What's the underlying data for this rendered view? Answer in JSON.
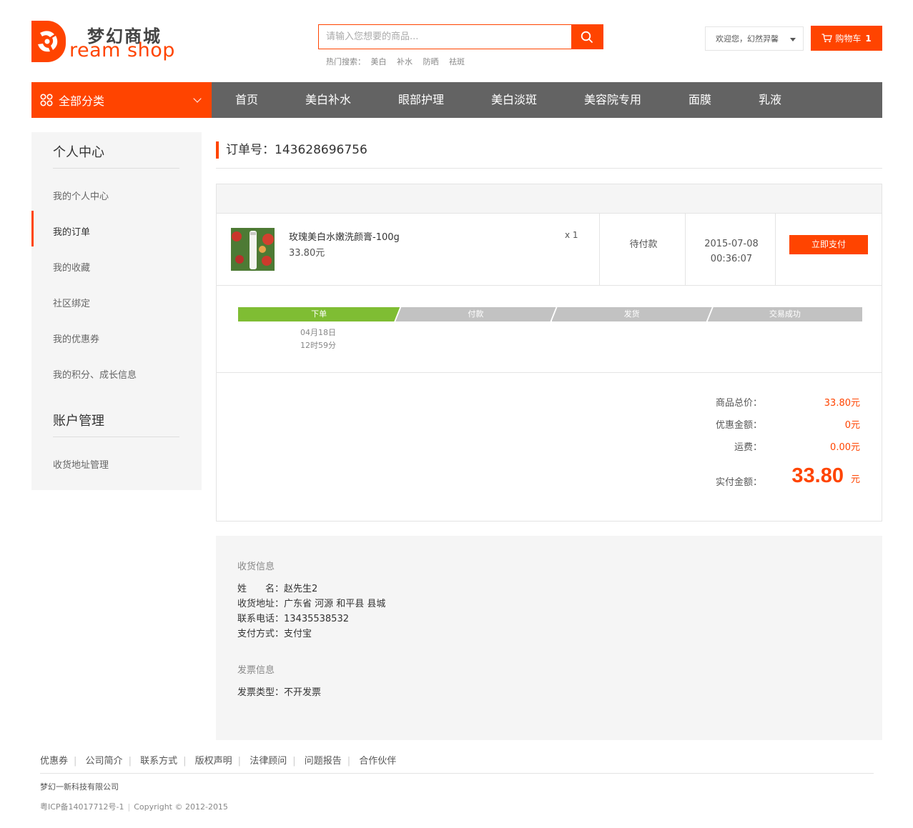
{
  "brand": {
    "name_cn": "梦幻商城",
    "name_en": "ream shop",
    "accent": "#ff4400",
    "nav_bg": "#636363"
  },
  "search": {
    "placeholder": "请输入您想要的商品...",
    "icon": "search-icon",
    "hot_label": "热门搜索：",
    "hot_terms": [
      "美白",
      "补水",
      "防晒",
      "祛斑"
    ]
  },
  "user": {
    "welcome": "欢迎您，幻然羿馨",
    "cart_label": "购物车",
    "cart_count": "1"
  },
  "nav": {
    "all_categories": "全部分类",
    "items": [
      "首页",
      "美白补水",
      "眼部护理",
      "美白淡斑",
      "美容院专用",
      "面膜",
      "乳液"
    ]
  },
  "sidebar": {
    "section1_title": "个人中心",
    "section1_items": [
      "我的个人中心",
      "我的订单",
      "我的收藏",
      "社区绑定",
      "我的优惠券",
      "我的积分、成长信息"
    ],
    "active_item": "我的订单",
    "section2_title": "账户管理",
    "section2_items": [
      "收货地址管理"
    ]
  },
  "order": {
    "title": "订单号：143628696756",
    "product_name": "玫瑰美白水嫩洗颜膏-100g",
    "product_price": "33.80元",
    "quantity": "x 1",
    "status": "待付款",
    "date": "2015-07-08",
    "time": "00:36:07",
    "pay_button": "立即支付",
    "steps": [
      "下单",
      "付款",
      "发货",
      "交易成功"
    ],
    "completed_steps": 1,
    "step1_date": "04月18日",
    "step1_time": "12时59分",
    "step_done_color": "#7fbd33",
    "step_todo_color": "#c2c2c2"
  },
  "summary": {
    "goods_label": "商品总价：",
    "goods_value": "33.80元",
    "discount_label": "优惠金额：",
    "discount_value": "0元",
    "shipping_label": "运费：",
    "shipping_value": "0.00元",
    "paid_label": "实付金额：",
    "paid_value": "33.80",
    "paid_unit": "元"
  },
  "shipping_info": {
    "heading": "收货信息",
    "name": "姓　　名：赵先生2",
    "address": "收货地址：广东省 河源 和平县 县城",
    "phone": "联系电话：13435538532",
    "payment": "支付方式：支付宝"
  },
  "invoice_info": {
    "heading": "发票信息",
    "type": "发票类型：不开发票"
  },
  "footer": {
    "links": [
      "优惠券",
      "公司简介",
      "联系方式",
      "版权声明",
      "法律顾问",
      "问题报告",
      "合作伙伴"
    ],
    "company": "梦幻一新科技有限公司",
    "icp": "粤ICP备14017712号-1",
    "copyright": "Copyright © 2012-2015"
  }
}
